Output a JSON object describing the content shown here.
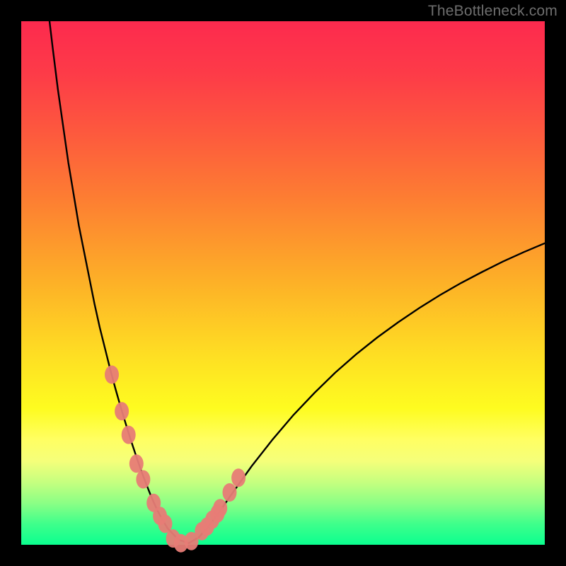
{
  "watermark": "TheBottleneck.com",
  "chart_data": {
    "type": "line",
    "title": "",
    "xlabel": "",
    "ylabel": "",
    "xlim": [
      0,
      100
    ],
    "ylim": [
      0,
      100
    ],
    "grid": false,
    "curve": {
      "name": "bottleneck-curve",
      "x": [
        5.4,
        6,
        7,
        8,
        9,
        10,
        11,
        12,
        13,
        14,
        15,
        16,
        17,
        18,
        19,
        20,
        21,
        22,
        23,
        24,
        25,
        26,
        27,
        28,
        30,
        32,
        34,
        36,
        38,
        40,
        44,
        48,
        52,
        56,
        60,
        64,
        68,
        72,
        76,
        80,
        84,
        88,
        92,
        96,
        100
      ],
      "y": [
        100,
        95,
        87,
        80,
        73,
        67,
        61,
        56,
        51,
        46,
        41.5,
        37.5,
        33.5,
        29.8,
        26.3,
        23,
        19.8,
        16.8,
        13.9,
        11.3,
        8.8,
        6.6,
        4.7,
        3.1,
        1,
        0.3,
        1.5,
        3.8,
        6.5,
        9.4,
        15,
        20.1,
        24.8,
        29,
        32.9,
        36.4,
        39.6,
        42.5,
        45.2,
        47.7,
        50,
        52.1,
        54.1,
        55.9,
        57.6
      ]
    },
    "series": [
      {
        "name": "highlight-dots",
        "x": [
          17.3,
          19.2,
          20.5,
          22.0,
          23.3,
          25.3,
          26.5,
          27.5,
          29.0,
          30.5,
          32.5,
          34.5,
          35.5,
          36.5,
          37.5,
          38.0,
          39.8,
          41.5
        ],
        "y": [
          32.5,
          25.5,
          21.0,
          15.5,
          12.5,
          8.0,
          5.5,
          4.0,
          1.2,
          0.3,
          0.7,
          2.6,
          3.5,
          4.8,
          6.0,
          7.0,
          10.0,
          12.8
        ]
      }
    ],
    "background_gradient": {
      "stops": [
        {
          "pos": 0,
          "color": "#fd2a4e"
        },
        {
          "pos": 50,
          "color": "#fdb127"
        },
        {
          "pos": 80,
          "color": "#ffff63"
        },
        {
          "pos": 100,
          "color": "#0bff8f"
        }
      ]
    }
  }
}
